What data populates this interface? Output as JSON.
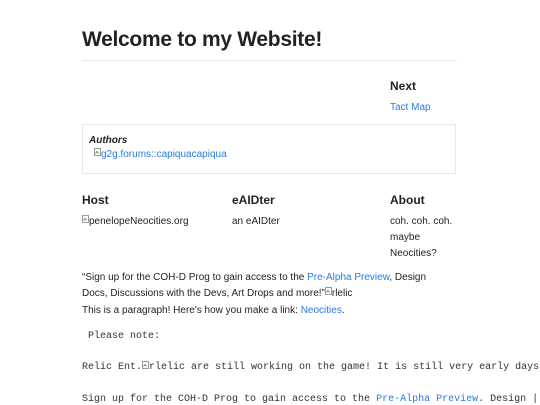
{
  "page": {
    "title": "Welcome to my Website!"
  },
  "next": {
    "heading": "Next",
    "link_label": "Tact Map"
  },
  "authors": {
    "heading": "Authors",
    "img_alt": "g2g.forums::capiquacapiqua"
  },
  "columns": {
    "host": {
      "heading": "Host",
      "img_alt": "penelopeNeocities.org"
    },
    "editor": {
      "heading": "eAIDter",
      "text": "an eAIDter"
    },
    "about": {
      "heading": "About",
      "lines": [
        "coh. coh. coh.",
        "maybe",
        "Neocities?"
      ]
    }
  },
  "quote": {
    "part1": "“Sign up for the COH-D Prog to gain access to the ",
    "link1": "Pre-Alpha Preview",
    "part2": ", Design",
    "part3": "Docs, Discussions with the Devs, Art Drops and more!”",
    "img_alt": "rlelic"
  },
  "paragraph": {
    "text": "This is a paragraph! Here's how you make a link: ",
    "link": "Neocities",
    "end": "."
  },
  "pre": {
    "note": "Please note:",
    "line1_start": "Relic Ent.",
    "line1_img_alt": "rlelic",
    "line1_end": " are still working on the game! It is still very early days i",
    "line2_start": "Sign up for the COH-D Prog to gain access to the ",
    "line2_link": "Pre-Alpha Preview",
    "line2_end": ". Design |"
  }
}
